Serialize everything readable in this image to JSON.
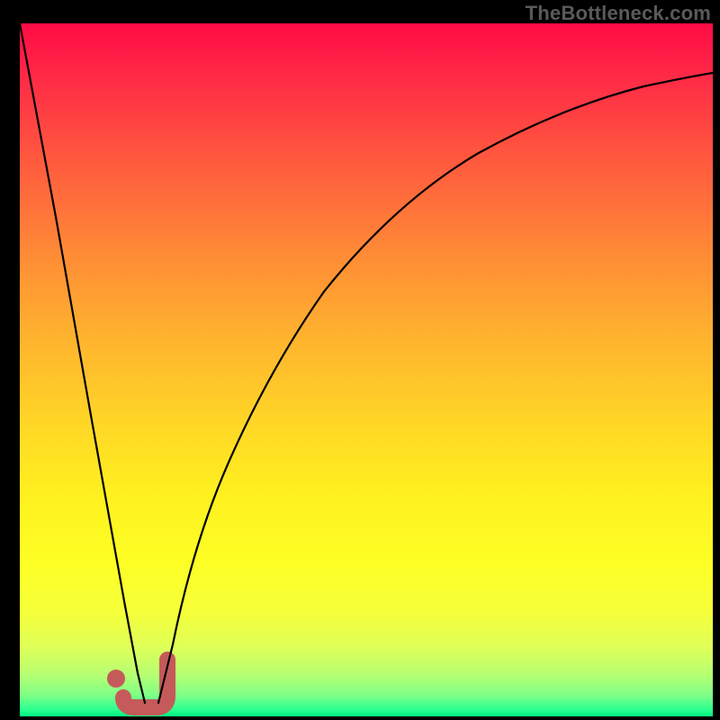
{
  "watermark": "TheBottleneck.com",
  "chart_data": {
    "type": "line",
    "title": "",
    "xlabel": "",
    "ylabel": "",
    "xlim": [
      0,
      100
    ],
    "ylim": [
      0,
      100
    ],
    "grid": false,
    "legend": false,
    "series": [
      {
        "name": "left-branch",
        "x": [
          0,
          5,
          10,
          15,
          17,
          18
        ],
        "y": [
          100,
          72,
          44,
          16,
          6,
          2
        ]
      },
      {
        "name": "right-branch",
        "x": [
          20,
          22,
          25,
          30,
          36,
          44,
          54,
          66,
          80,
          92,
          100
        ],
        "y": [
          2,
          10,
          25,
          45,
          60,
          72,
          80,
          86,
          90,
          92,
          93
        ]
      }
    ],
    "annotations": [
      {
        "name": "j-marker",
        "shape": "J",
        "x": 19,
        "y": 4,
        "color": "#c55a5a"
      }
    ],
    "background_gradient": {
      "top": "#ff0b45",
      "mid": "#ffd726",
      "bottom": "#00f77e"
    }
  }
}
